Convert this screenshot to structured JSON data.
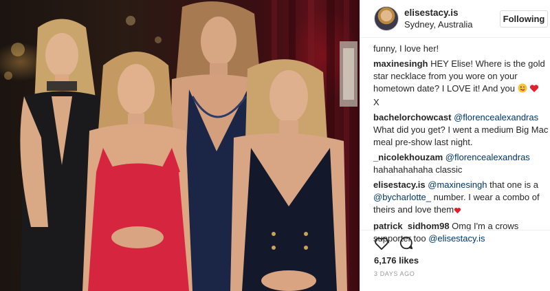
{
  "post": {
    "username": "elisestacy.is",
    "location": "Sydney, Australia",
    "follow_label": "Following"
  },
  "comments": [
    {
      "user": "",
      "text": "funny, I love her!"
    },
    {
      "user": "maxinesingh",
      "text": "HEY Elise! Where is the gold star necklace from you wore on your hometown date? I LOVE it! And you",
      "trail": "X"
    },
    {
      "user": "bachelorchowcast",
      "mention": "@florencealexandras",
      "text": "What did you get? I went a medium Big Mac meal pre-show last night."
    },
    {
      "user": "_nicolekhouzam",
      "mention": "@florencealexandras",
      "text": "hahahahahaha classic"
    },
    {
      "user": "elisestacy.is",
      "mention": "@maxinesingh",
      "text": "that one is a",
      "mention2": "@bycharlotte_",
      "text2": "number. I wear a combo of theirs and love them"
    },
    {
      "user": "patrick_sidhom98",
      "text": "Omg I'm a crows supporter too",
      "mention": "@elisestacy.is"
    }
  ],
  "footer": {
    "likes": "6,176 likes",
    "time": "3 DAYS AGO"
  },
  "icons": {
    "like": "heart-outline-icon",
    "comment": "speech-bubble-icon"
  }
}
